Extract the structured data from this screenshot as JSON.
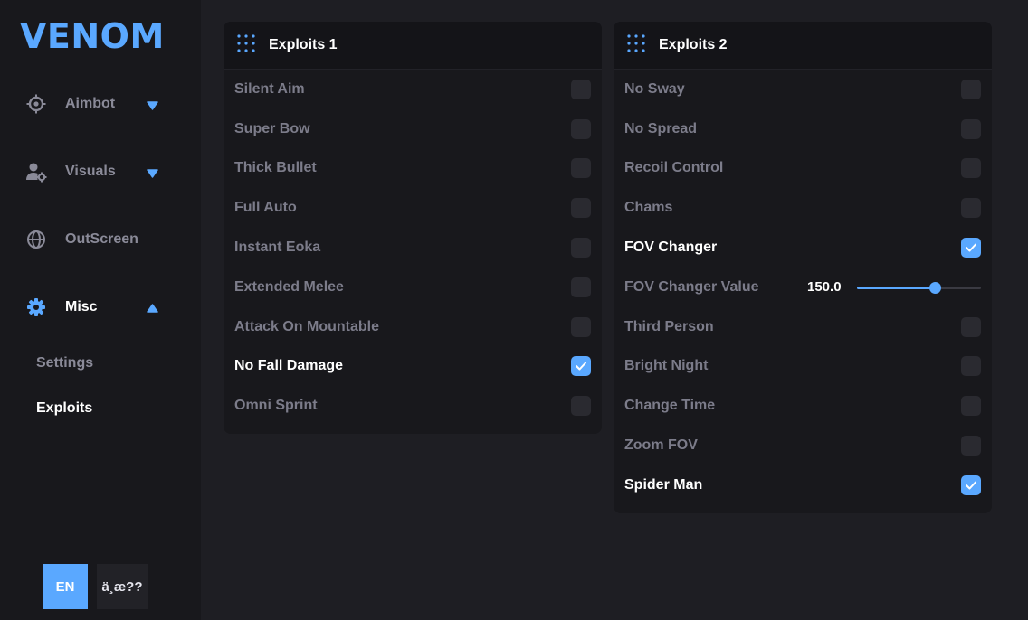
{
  "brand": {
    "logo": "VENOM",
    "accent": "#5aa8ff"
  },
  "sidebar": {
    "items": [
      {
        "label": "Aimbot",
        "icon": "crosshair-icon",
        "caret": "down"
      },
      {
        "label": "Visuals",
        "icon": "user-gear-icon",
        "caret": "down"
      },
      {
        "label": "OutScreen",
        "icon": "globe-icon"
      },
      {
        "label": "Misc",
        "icon": "gear-icon",
        "caret": "up",
        "active": true
      }
    ],
    "subitems": [
      {
        "label": "Settings",
        "active": false
      },
      {
        "label": "Exploits",
        "active": true
      }
    ],
    "languages": [
      {
        "label": "EN",
        "selected": true
      },
      {
        "label": "ä¸­æ??",
        "selected": false
      }
    ]
  },
  "panels": [
    {
      "title": "Exploits 1",
      "icon": "grid-dots-icon",
      "rows": [
        {
          "label": "Silent Aim",
          "checked": false
        },
        {
          "label": "Super Bow",
          "checked": false
        },
        {
          "label": "Thick Bullet",
          "checked": false
        },
        {
          "label": "Full Auto",
          "checked": false
        },
        {
          "label": "Instant Eoka",
          "checked": false
        },
        {
          "label": "Extended Melee",
          "checked": false
        },
        {
          "label": "Attack On Mountable",
          "checked": false
        },
        {
          "label": "No Fall Damage",
          "checked": true
        },
        {
          "label": "Omni Sprint",
          "checked": false
        }
      ]
    },
    {
      "title": "Exploits 2",
      "icon": "grid-dots-icon",
      "rows": [
        {
          "label": "No Sway",
          "checked": false
        },
        {
          "label": "No Spread",
          "checked": false
        },
        {
          "label": "Recoil Control",
          "checked": false
        },
        {
          "label": "Chams",
          "checked": false
        },
        {
          "label": "FOV Changer",
          "checked": true
        },
        {
          "label": "FOV Changer Value",
          "slider": true,
          "value": "150.0",
          "fraction": 0.63
        },
        {
          "label": "Third Person",
          "checked": false
        },
        {
          "label": "Bright Night",
          "checked": false
        },
        {
          "label": "Change Time",
          "checked": false
        },
        {
          "label": "Zoom FOV",
          "checked": false
        },
        {
          "label": "Spider Man",
          "checked": true
        }
      ]
    }
  ]
}
